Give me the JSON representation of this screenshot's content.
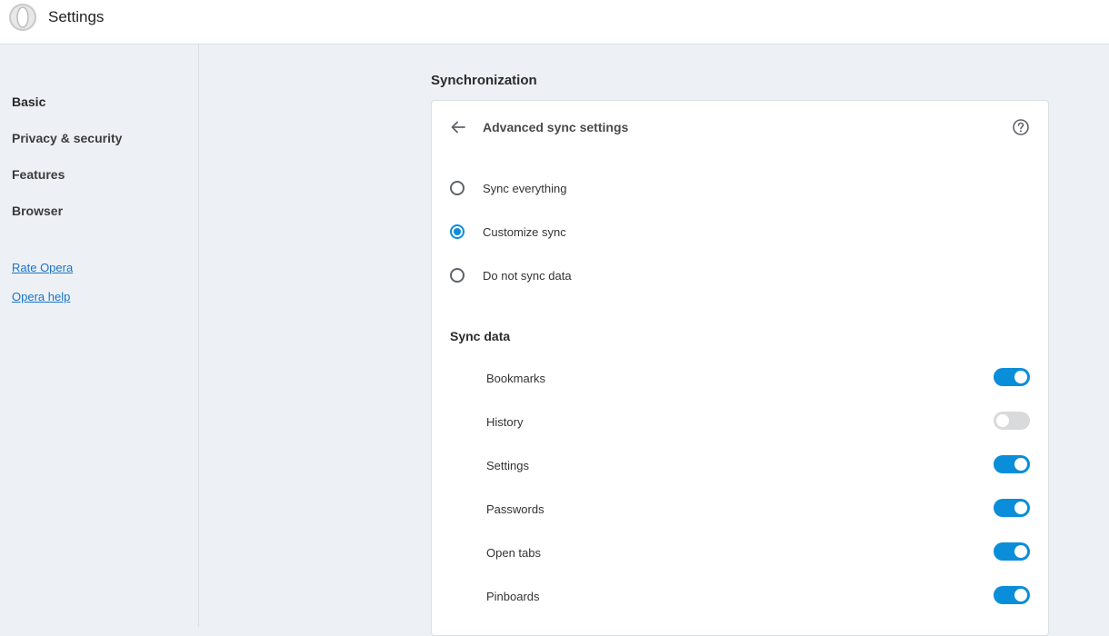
{
  "app": {
    "title": "Settings"
  },
  "sidebar": {
    "items": [
      {
        "label": "Basic",
        "active": true
      },
      {
        "label": "Privacy & security",
        "active": false
      },
      {
        "label": "Features",
        "active": false
      },
      {
        "label": "Browser",
        "active": false
      }
    ],
    "links": [
      {
        "label": "Rate Opera"
      },
      {
        "label": "Opera help"
      }
    ]
  },
  "main": {
    "section_title": "Synchronization",
    "card": {
      "header_title": "Advanced sync settings",
      "sync_options": [
        {
          "label": "Sync everything",
          "selected": false
        },
        {
          "label": "Customize sync",
          "selected": true
        },
        {
          "label": "Do not sync data",
          "selected": false
        }
      ],
      "sync_data_title": "Sync data",
      "sync_items": [
        {
          "label": "Bookmarks",
          "enabled": true
        },
        {
          "label": "History",
          "enabled": false
        },
        {
          "label": "Settings",
          "enabled": true
        },
        {
          "label": "Passwords",
          "enabled": true
        },
        {
          "label": "Open tabs",
          "enabled": true
        },
        {
          "label": "Pinboards",
          "enabled": true
        }
      ]
    }
  },
  "colors": {
    "accent": "#0a8ed9",
    "toggle_off": "#d9dadc",
    "link": "#1a73c7",
    "background": "#edf1f5"
  },
  "icons": {
    "logo": "opera-logo-icon",
    "back": "arrow-left-icon",
    "help": "help-circle-icon"
  }
}
